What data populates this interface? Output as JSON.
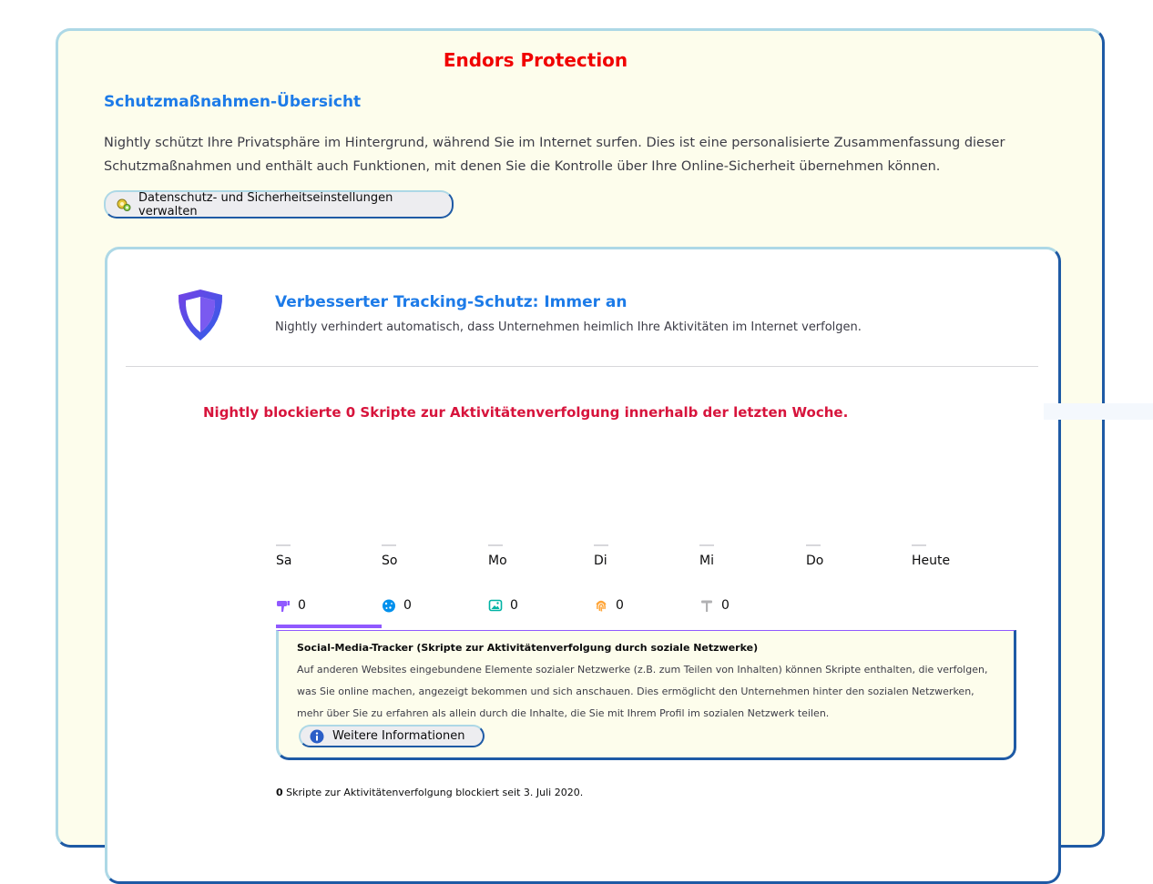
{
  "app": {
    "title": "Endors Protection"
  },
  "overview": {
    "heading": "Schutzmaßnahmen-Übersicht",
    "intro": "Nightly schützt Ihre Privatsphäre im Hintergrund, während Sie im Internet surfen. Dies ist eine personalisierte Zusammenfassung dieser Schutzmaßnahmen und enthält auch Funktionen, mit denen Sie die Kontrolle über Ihre Online-Sicherheit übernehmen können.",
    "settings_button": "Datenschutz- und Sicherheitseinstellungen verwalten"
  },
  "etp": {
    "title": "Verbesserter Tracking-Schutz: Immer an",
    "description": "Nightly verhindert automatisch, dass Unternehmen heimlich Ihre Aktivitäten im Internet verfolgen.",
    "blocked_message": "Nightly blockierte 0 Skripte zur Aktivitätenverfolgung innerhalb der letzten Woche.",
    "days": [
      "Sa",
      "So",
      "Mo",
      "Di",
      "Mi",
      "Do",
      "Heute"
    ],
    "day_counts": [
      0,
      0,
      0,
      0,
      0,
      0,
      0
    ],
    "tabs": [
      {
        "icon": "thumbs-down-icon",
        "count": "0",
        "color": "#9059ff"
      },
      {
        "icon": "cookie-icon",
        "count": "0",
        "color": "#0090ed"
      },
      {
        "icon": "image-icon",
        "count": "0",
        "color": "#00b3a4"
      },
      {
        "icon": "fingerprint-icon",
        "count": "0",
        "color": "#ffa436"
      },
      {
        "icon": "hammer-icon",
        "count": "0",
        "color": "#b1b1b3"
      }
    ],
    "active_tab": 0,
    "panel": {
      "title": "Social-Media-Tracker (Skripte zur Aktivitätenverfolgung durch soziale Netzwerke)",
      "text": "Auf anderen Websites eingebundene Elemente sozialer Netzwerke (z.B. zum Teilen von Inhalten) können Skripte enthalten, die verfolgen, was Sie online machen, angezeigt bekommen und sich anschauen. Dies ermöglicht den Unternehmen hinter den sozialen Netzwerken, mehr über Sie zu erfahren als allein durch die Inhalte, die Sie mit Ihrem Profil im sozialen Netzwerk teilen.",
      "more_button": "Weitere Informationen"
    },
    "footer_count": "0",
    "footer_text": "Skripte zur Aktivitätenverfolgung blockiert seit 3. Juli 2020."
  },
  "colors": {
    "title_red": "#f00000",
    "heading_blue": "#1d7be8",
    "blocked_red": "#d7143c",
    "accent_purple": "#9059ff",
    "page_bg": "#fdfdec"
  }
}
